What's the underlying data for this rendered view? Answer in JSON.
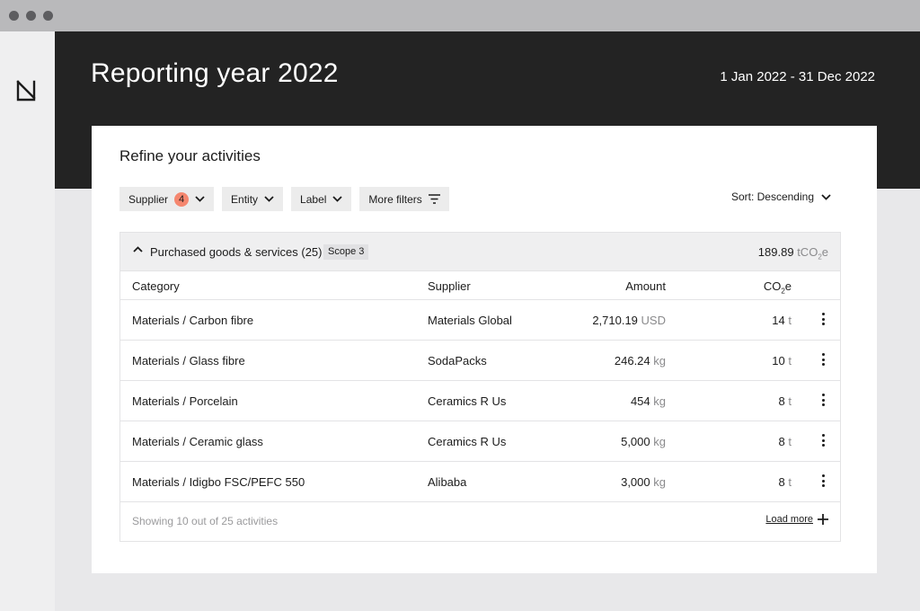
{
  "window": {
    "controls": [
      "close",
      "minimize",
      "maximize"
    ]
  },
  "sidebar": {
    "logo_icon": "logo-n-icon"
  },
  "header": {
    "title": "Reporting year 2022",
    "date_range": "1 Jan 2022 - 31 Dec 2022"
  },
  "card": {
    "title": "Refine your activities",
    "filters": {
      "supplier_label": "Supplier",
      "supplier_count": "4",
      "entity_label": "Entity",
      "label_label": "Label",
      "more_filters_label": "More filters"
    },
    "sort_label": "Sort: Descending",
    "group": {
      "title": "Purchased goods & services (25)",
      "scope": "Scope 3",
      "total_value": "189.89",
      "total_unit_prefix": "tCO",
      "total_unit_sub": "2",
      "total_unit_suffix": "e"
    },
    "columns": {
      "category": "Category",
      "supplier": "Supplier",
      "amount": "Amount",
      "co2_prefix": "CO",
      "co2_sub": "2",
      "co2_suffix": "e"
    },
    "rows": [
      {
        "category": "Materials / Carbon fibre",
        "supplier": "Materials Global",
        "amount": "2,710.19",
        "amount_unit": "USD",
        "co2": "14",
        "co2_unit": "t"
      },
      {
        "category": "Materials / Glass fibre",
        "supplier": "SodaPacks",
        "amount": "246.24",
        "amount_unit": "kg",
        "co2": "10",
        "co2_unit": "t"
      },
      {
        "category": "Materials / Porcelain",
        "supplier": "Ceramics R Us",
        "amount": "454",
        "amount_unit": "kg",
        "co2": "8",
        "co2_unit": "t"
      },
      {
        "category": "Materials / Ceramic glass",
        "supplier": "Ceramics R Us",
        "amount": "5,000",
        "amount_unit": "kg",
        "co2": "8",
        "co2_unit": "t"
      },
      {
        "category": "Materials / Idigbo FSC/PEFC 550",
        "supplier": "Alibaba",
        "amount": "3,000",
        "amount_unit": "kg",
        "co2": "8",
        "co2_unit": "t"
      }
    ],
    "footer": {
      "showing": "Showing 10 out of 25 activities",
      "load_more": "Load more"
    }
  },
  "colors": {
    "header_bg": "#232323",
    "badge": "#f5876f",
    "page_bg": "#e8e8ea"
  }
}
